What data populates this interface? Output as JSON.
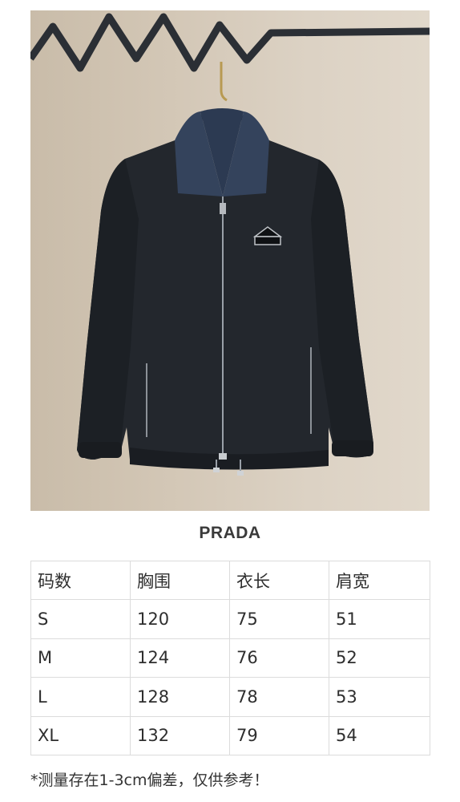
{
  "photo": {
    "subject": "jacket-product-photo",
    "colors": {
      "background": "#d6cab9",
      "jacket": "#23272d",
      "collar": "#34435c",
      "rack": "#2b2f35",
      "hanger_hook": "#b89a52"
    }
  },
  "brand": "PRADA",
  "size_table": {
    "headers": [
      "码数",
      "胸围",
      "衣长",
      "肩宽"
    ],
    "rows": [
      [
        "S",
        "120",
        "75",
        "51"
      ],
      [
        "M",
        "124",
        "76",
        "52"
      ],
      [
        "L",
        "128",
        "78",
        "53"
      ],
      [
        "XL",
        "132",
        "79",
        "54"
      ]
    ]
  },
  "note": "*测量存在1-3cm偏差，仅供参考！"
}
